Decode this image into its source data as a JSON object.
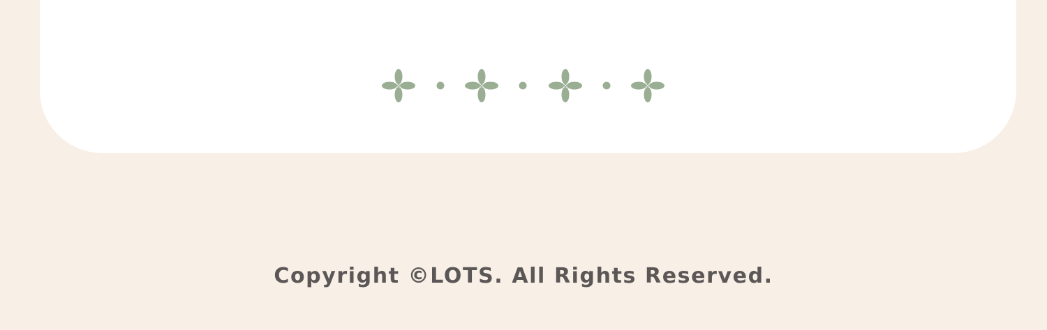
{
  "footer": {
    "copyright": "Copyright ©LOTS. All Rights Reserved."
  },
  "decor": {
    "flower_color": "#9aae93",
    "background_color": "#f8efe6",
    "card_color": "#ffffff",
    "text_color": "#5b5756",
    "icons": [
      "flower-icon",
      "dot-icon",
      "flower-icon",
      "dot-icon",
      "flower-icon",
      "dot-icon",
      "flower-icon"
    ]
  }
}
